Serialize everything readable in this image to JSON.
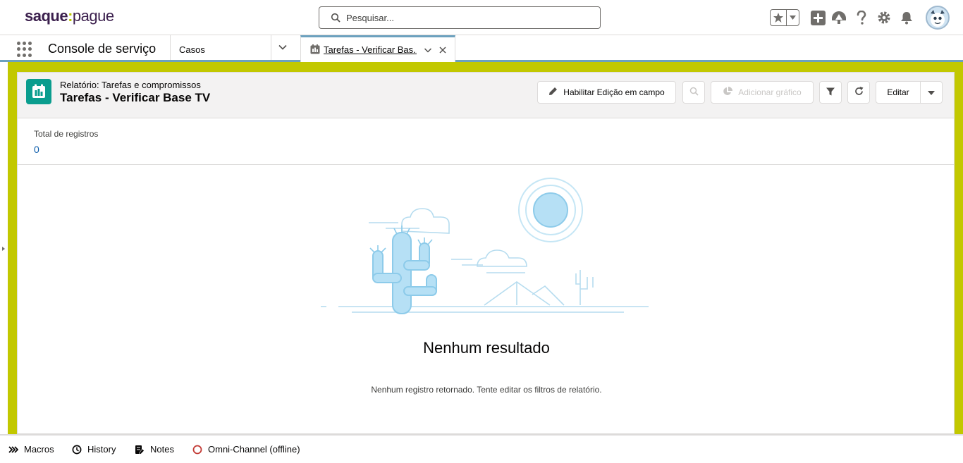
{
  "logo": {
    "part1": "saque",
    "part2": "pague"
  },
  "search": {
    "placeholder": "Pesquisar..."
  },
  "navbar": {
    "app_name": "Console de serviço",
    "nav_item": "Casos",
    "tab_label": "Tarefas - Verificar Bas..."
  },
  "report": {
    "subtitle": "Relatório: Tarefas e compromissos",
    "title": "Tarefas - Verificar Base TV",
    "buttons": {
      "inline_edit": "Habilitar Edição em campo",
      "add_chart": "Adicionar gráfico",
      "edit": "Editar"
    },
    "total_label": "Total de registros",
    "total_value": "0",
    "empty_title": "Nenhum resultado",
    "empty_message": "Nenhum registro retornado. Tente editar os filtros de relatório."
  },
  "utility_bar": {
    "macros": "Macros",
    "history": "History",
    "notes": "Notes",
    "omni": "Omni-Channel (offline)"
  },
  "colors": {
    "frame": "#c2c800",
    "tab_accent": "#6ca1be",
    "report_icon": "#0a9d8e",
    "link": "#0b5cab"
  }
}
